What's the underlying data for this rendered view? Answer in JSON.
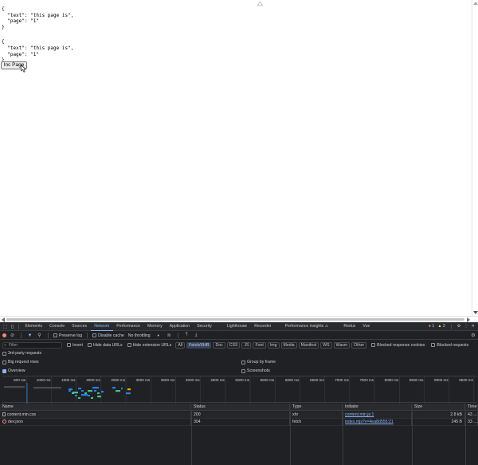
{
  "page": {
    "json_blocks": [
      "{\n  \"text\": \"this page is\",\n  \"page\": \"1\"\n}",
      "{\n  \"text\": \"this page is\",\n  \"page\": \"1\"\n}"
    ],
    "inc_button_label": "Inc Page"
  },
  "devtools": {
    "tabs": [
      {
        "label": "Elements",
        "active": false
      },
      {
        "label": "Console",
        "active": false
      },
      {
        "label": "Sources",
        "active": false
      },
      {
        "label": "Network",
        "active": true
      },
      {
        "label": "Performance",
        "active": false
      },
      {
        "label": "Memory",
        "active": false
      },
      {
        "label": "Application",
        "active": false
      },
      {
        "label": "Security",
        "active": false
      },
      {
        "label": "Lighthouse",
        "active": false
      },
      {
        "label": "Recorder",
        "active": false
      },
      {
        "label": "Performance insights ⚠",
        "active": false
      },
      {
        "label": "Redux",
        "active": false
      },
      {
        "label": "Vue",
        "active": false
      }
    ],
    "error_count": "1",
    "warning_count": "2",
    "toolbar": {
      "preserve_log": "Preserve log",
      "disable_cache": "Disable cache",
      "throttling": "No throttling"
    },
    "filter": {
      "placeholder": "Filter",
      "invert": "Invert",
      "hide_data_urls": "Hide data URLs",
      "hide_extension_urls": "Hide extension URLs",
      "types": [
        {
          "label": "All",
          "active": false
        },
        {
          "label": "Fetch/XHR",
          "active": true
        },
        {
          "label": "Doc",
          "active": false
        },
        {
          "label": "CSS",
          "active": false
        },
        {
          "label": "JS",
          "active": false
        },
        {
          "label": "Font",
          "active": false
        },
        {
          "label": "Img",
          "active": false
        },
        {
          "label": "Media",
          "active": false
        },
        {
          "label": "Manifest",
          "active": false
        },
        {
          "label": "WS",
          "active": false
        },
        {
          "label": "Wasm",
          "active": false
        },
        {
          "label": "Other",
          "active": false
        }
      ],
      "blocked_response_cookies": "Blocked response cookies",
      "blocked_requests": "Blocked requests"
    },
    "options": {
      "third_party": "3rd-party requests",
      "big_request_rows": "Big request rows",
      "group_by_frame": "Group by frame",
      "overview": "Overview",
      "screenshots": "Screenshots"
    },
    "timeline_ticks": [
      "500 ms",
      "1000 ms",
      "1500 ms",
      "2000 ms",
      "2500 ms",
      "3000 ms",
      "3500 ms",
      "4000 ms",
      "4500 ms",
      "5000 ms",
      "5500 ms",
      "6000 ms",
      "6500 ms",
      "7000 ms",
      "7500 ms",
      "8000 ms",
      "8500 ms",
      "9000 ms",
      "9500 ms"
    ],
    "columns": [
      "Name",
      "Status",
      "Type",
      "Initiator",
      "Size",
      "Time"
    ],
    "rows": [
      {
        "name": "content.min.css",
        "status": "200",
        "type": "xhr",
        "initiator": "content.min.js:1",
        "size": "2.8 kB",
        "time": "43 ..."
      },
      {
        "name": "dev.json",
        "status": "304",
        "type": "fetch",
        "initiator": "index.mjs?v=4ea8d555:21",
        "size": "245 B",
        "time": "33 ..."
      }
    ]
  }
}
